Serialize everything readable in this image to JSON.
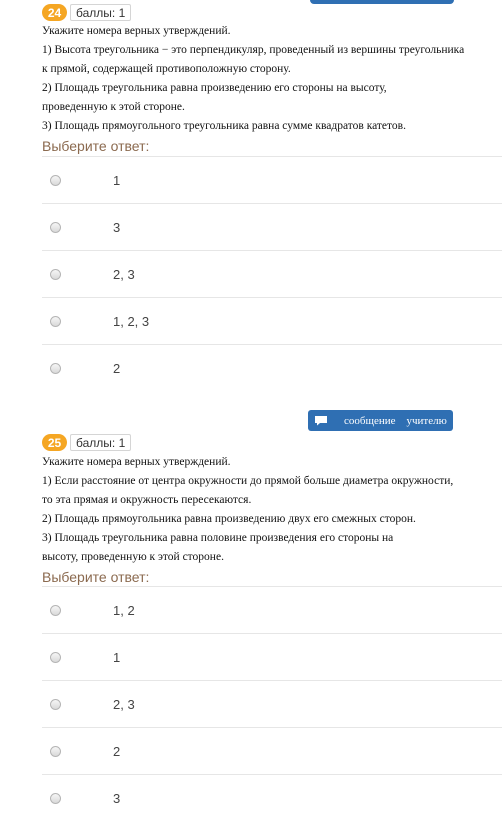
{
  "questions": [
    {
      "number": "24",
      "points_label": "баллы: 1",
      "text": "Укажите номера верных утверждений.\n1) Высота треугольника − это перпендикуляр, проведенный из вершины треугольника\nк прямой, содержащей противоположную сторону.\n2) Площадь треугольника равна произведению его стороны на высоту,\nпроведенную к этой стороне.\n3) Площадь прямоугольного треугольника равна сумме квадратов катетов.",
      "prompt": "Выберите ответ:",
      "answers": [
        "1",
        "3",
        "2, 3",
        "1, 2, 3",
        "2"
      ]
    },
    {
      "number": "25",
      "points_label": "баллы: 1",
      "text": "Укажите номера верных утверждений.\n1) Если расстояние от центра окружности до прямой больше диаметра окружности,\n то эта прямая и окружность пересекаются.\n2) Площадь прямоугольника равна произведению двух его смежных сторон.\n3) Площадь треугольника равна половине произведения его стороны на\nвысоту, проведенную к этой стороне.",
      "prompt": "Выберите ответ:",
      "answers": [
        "1, 2",
        "1",
        "2, 3",
        "2",
        "3"
      ]
    }
  ],
  "message_button": {
    "label": "сообщение    учителю",
    "icon": "speech-bubble-icon"
  },
  "colors": {
    "badge": "#f5a623",
    "prompt": "#8b6a4f",
    "button": "#2f6fb3"
  }
}
